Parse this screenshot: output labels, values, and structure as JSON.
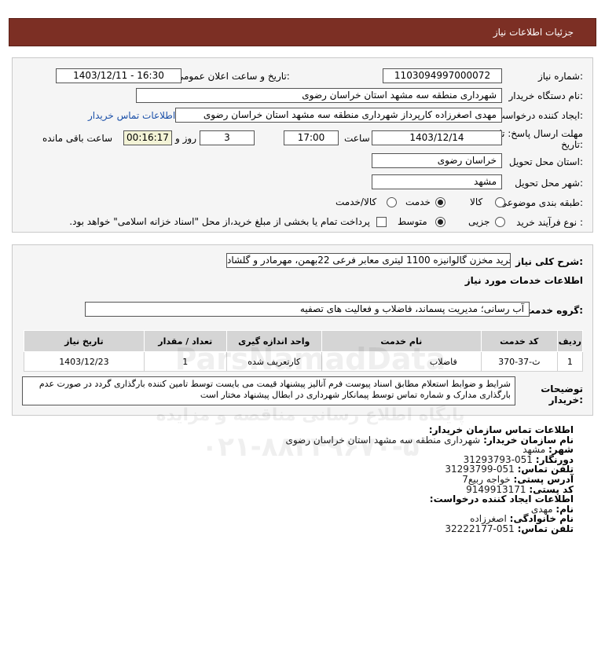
{
  "header": {
    "title": "جزئیات اطلاعات نیاز"
  },
  "details": {
    "need_number_label": "شماره نیاز:",
    "need_number": "1103094997000072",
    "announce_label": "تاریخ و ساعت اعلان عمومی:",
    "announce_value": "1403/12/11 - 16:30",
    "buyer_org_label": "نام دستگاه خریدار:",
    "buyer_org": "شهرداری منطقه سه مشهد استان خراسان رضوی",
    "creator_label": "ایجاد کننده درخواست:",
    "creator": "مهدی اصغرزاده کارپرداز شهرداری منطقه سه مشهد استان خراسان رضوی",
    "contact_link": "اطلاعات تماس خریدار",
    "deadline_label_1": "مهلت ارسال پاسخ: تا",
    "deadline_label_2": "تاریخ:",
    "deadline_date": "1403/12/14",
    "time_label": "ساعت",
    "deadline_time": "17:00",
    "days_value": "3",
    "days_label": "روز و",
    "remaining_time": "00:16:17",
    "remaining_label": "ساعت باقی مانده",
    "province_label": "استان محل تحویل:",
    "province": "خراسان رضوی",
    "city_label": "شهر محل تحویل:",
    "city": "مشهد",
    "category_label": "طبقه بندی موضوعی:",
    "category_options": [
      "کالا",
      "خدمت",
      "کالا/خدمت"
    ],
    "category_selected": "خدمت",
    "process_label": "نوع فرآیند خرید :",
    "process_options": [
      "جزیی",
      "متوسط"
    ],
    "process_selected": "متوسط",
    "payment_note": "پرداخت تمام یا بخشی از مبلغ خرید،از محل \"اسناد خزانه اسلامی\" خواهد بود."
  },
  "description": {
    "label": "شرح کلی نیاز:",
    "value": "خرید مخزن گالوانیزه 1100 لیتری معابر فرعی 22بهمن، مهرمادر و گلشاد",
    "services_heading": "اطلاعات خدمات مورد نیاز",
    "service_group_label": "گروه خدمت:",
    "service_group": "آب رسانی؛ مدیریت پسماند، فاضلاب و فعالیت های تصفیه",
    "table": {
      "headers": [
        "ردیف",
        "کد خدمت",
        "نام خدمت",
        "واحد اندازه گیری",
        "تعداد / مقدار",
        "تاریخ نیاز"
      ],
      "rows": [
        [
          "1",
          "ث-37-370",
          "فاضلاب",
          "کارتعریف شده",
          "1",
          "1403/12/23"
        ]
      ]
    },
    "notes_label_1": "توضیحات",
    "notes_label_2": "خریدار:",
    "notes": "شرایط و ضوابط استعلام مطابق اسناد پیوست فرم آنالیز پیشنهاد قیمت می بایست توسط تامین کننده بارگذاری گردد در صورت عدم بارگذاری مدارک و شماره تماس توسط پیمانکار شهرداری در ابطال پیشنهاد مختار است"
  },
  "contact": {
    "heading": "اطلاعات تماس سازمان خریدار:",
    "org_label": "نام سازمان خریدار:",
    "org": "شهرداری منطقه سه مشهد استان خراسان رضوی",
    "city_label": "شهر:",
    "city": "مشهد",
    "fax_label": "دورنگار:",
    "fax": "051-31293793",
    "phone_label": "تلفن تماس:",
    "phone": "051-31293799",
    "address_label": "آدرس پستی:",
    "address": "خواجه ربیع7",
    "postal_label": "کد پستی:",
    "postal": "9149913171",
    "creator_heading": "اطلاعات ایجاد کننده درخواست:",
    "name_label": "نام:",
    "name": "مهدی",
    "family_label": "نام خانوادگی:",
    "family": "اصغرزاده",
    "creator_phone_label": "تلفن تماس:",
    "creator_phone": "051-32222177"
  },
  "watermark": {
    "brand": "ParsNamadData",
    "line1": "پایگاه اطلاع رسانی مناقصه و مزایده",
    "phone": "۰۲۱-۸۸۳۴۹۶۷۰-۵",
    "color": "#9a9a9a"
  }
}
